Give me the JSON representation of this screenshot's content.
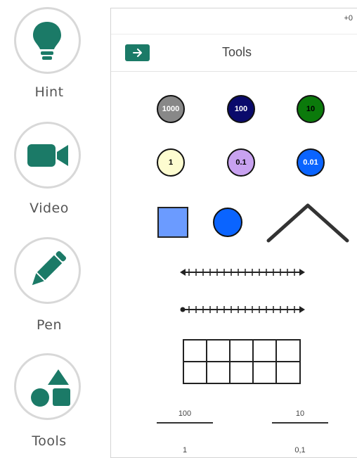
{
  "rail": {
    "items": [
      {
        "label": "Hint",
        "icon": "lightbulb-icon"
      },
      {
        "label": "Video",
        "icon": "video-camera-icon"
      },
      {
        "label": "Pen",
        "icon": "pencil-icon"
      },
      {
        "label": "Tools",
        "icon": "shapes-icon"
      }
    ]
  },
  "panel": {
    "title": "Tools",
    "zoom": "+0",
    "discs": [
      {
        "label": "1000",
        "color": "#888888",
        "text_color": "#ffffff"
      },
      {
        "label": "100",
        "color": "#0a0a6b",
        "text_color": "#ffffff"
      },
      {
        "label": "10",
        "color": "#0b7a0b",
        "text_color": "#000000"
      },
      {
        "label": "1",
        "color": "#fdfcd0",
        "text_color": "#000000"
      },
      {
        "label": "0.1",
        "color": "#c8a2f0",
        "text_color": "#000000"
      },
      {
        "label": "0.01",
        "color": "#0a64ff",
        "text_color": "#ffffff"
      }
    ],
    "fractions": {
      "a_num": "100",
      "b_num": "10",
      "a_den": "1",
      "b_den": "0,1"
    }
  },
  "colors": {
    "accent": "#1b7a67",
    "square": "#6b9bff",
    "circle": "#0a64ff"
  }
}
